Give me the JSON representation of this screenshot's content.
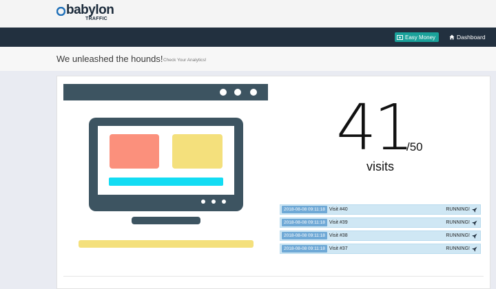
{
  "brand": {
    "name": "babylon",
    "subtitle": "TRAFFIC"
  },
  "nav": {
    "money_label": "Easy Money",
    "dashboard_label": "Dashboard"
  },
  "header": {
    "title": "We unleashed the hounds!",
    "subtitle": "Check Your Analytics!"
  },
  "stats": {
    "visits": "41",
    "max": "/50",
    "unit": "visits"
  },
  "visits": [
    {
      "timestamp": "2018-08-08 09:11:18",
      "label": "Visit #40",
      "status": "RUNNING!"
    },
    {
      "timestamp": "2018-08-08 09:11:18",
      "label": "Visit #39",
      "status": "RUNNING!"
    },
    {
      "timestamp": "2018-08-08 09:11:18",
      "label": "Visit #38",
      "status": "RUNNING!"
    },
    {
      "timestamp": "2018-08-08 09:11:18",
      "label": "Visit #37",
      "status": "RUNNING!"
    }
  ],
  "icons": {
    "logo": "babylon-logo-mark",
    "money": "money-icon",
    "dashboard": "home-icon",
    "status": "rocket-icon"
  },
  "colors": {
    "navbar": "#22303f",
    "accent_teal": "#1aa19a",
    "visit_row": "#cfe7f4",
    "visit_badge": "#6fa9d6"
  }
}
